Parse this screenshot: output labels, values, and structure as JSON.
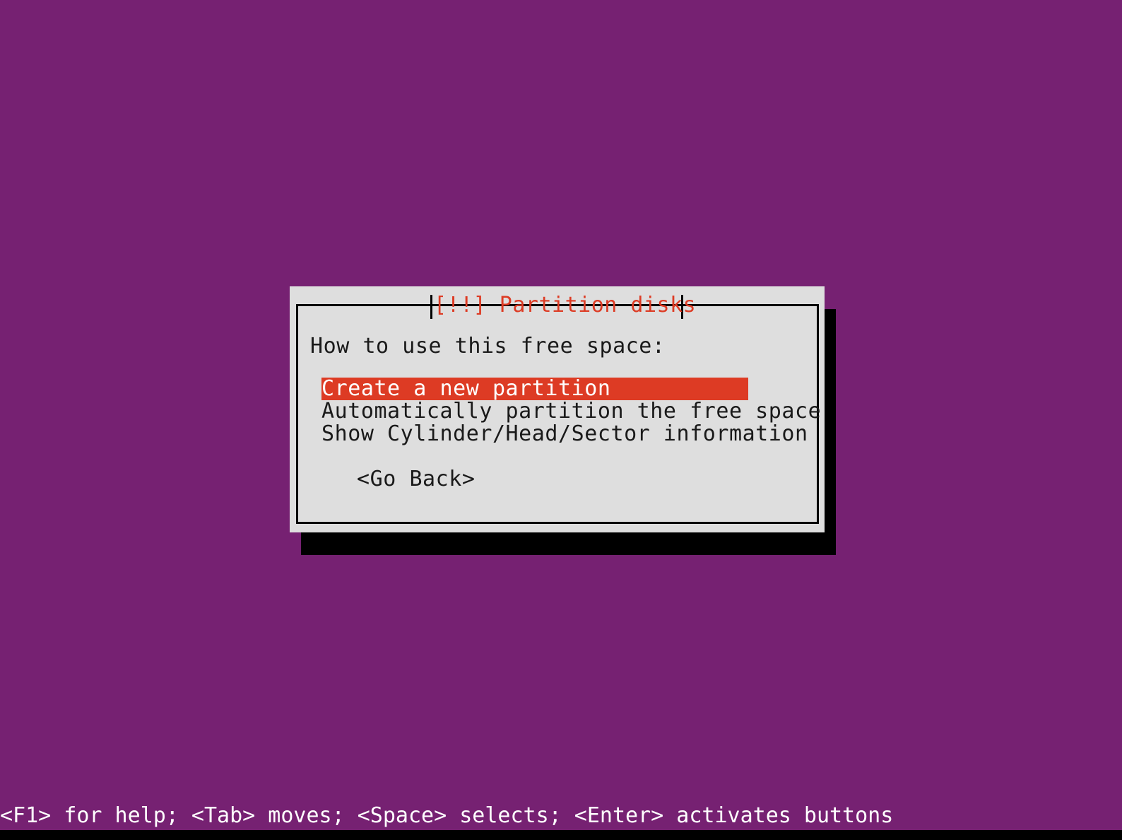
{
  "screen": {
    "background_color": "#762172",
    "accent_color": "#dd3b24",
    "dialog_background": "#dedede"
  },
  "dialog": {
    "title": "[!!] Partition disks",
    "prompt": "How to use this free space:",
    "menu_items": [
      {
        "label": "Create a new partition",
        "selected": true
      },
      {
        "label": "Automatically partition the free space",
        "selected": false
      },
      {
        "label": "Show Cylinder/Head/Sector information",
        "selected": false
      }
    ],
    "go_back_label": "<Go Back>"
  },
  "status_bar": {
    "text": "<F1> for help; <Tab> moves; <Space> selects; <Enter> activates buttons"
  }
}
